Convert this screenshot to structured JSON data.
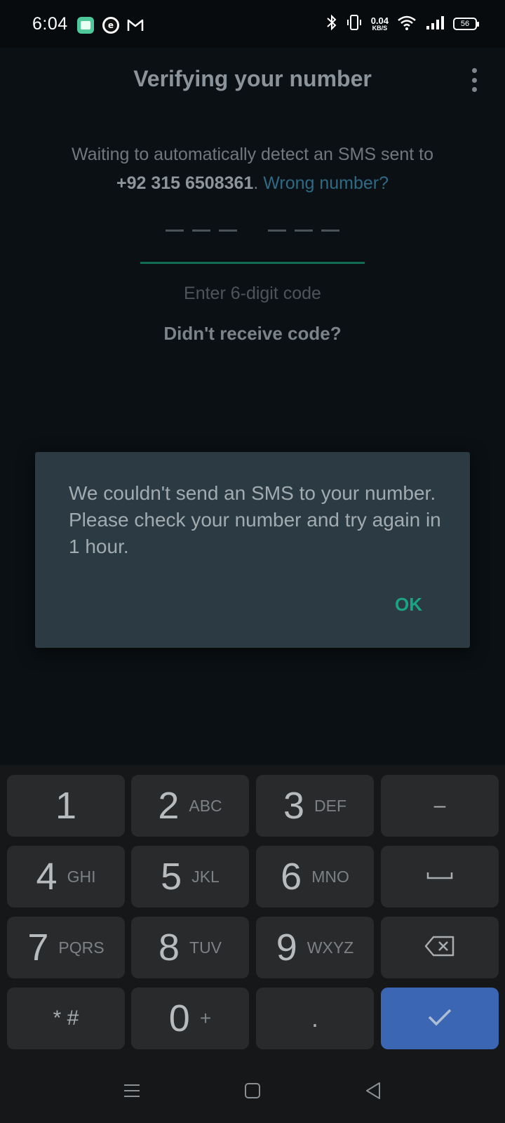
{
  "status_bar": {
    "time": "6:04",
    "net_speed_value": "0.04",
    "net_speed_unit": "KB/S",
    "battery": "56",
    "icons": [
      "app-green-icon",
      "app-e-icon",
      "gmail-icon",
      "bluetooth-icon",
      "vibrate-icon",
      "wifi-icon",
      "signal-icon",
      "battery-icon"
    ]
  },
  "header": {
    "title": "Verifying your number",
    "menu_icon": "more-vert-icon"
  },
  "verification": {
    "line1": "Waiting to automatically detect an SMS sent to",
    "phone": "+92 315 6508361",
    "period": ".",
    "wrong_number": "Wrong number?",
    "code_hint": "Enter 6-digit code",
    "resend": "Didn't receive code?"
  },
  "dialog": {
    "message": "We couldn't send an SMS to your number. Please check your number and try again in 1 hour.",
    "ok_label": "OK"
  },
  "keypad": {
    "rows": [
      [
        {
          "digit": "1",
          "letters": ""
        },
        {
          "digit": "2",
          "letters": "ABC"
        },
        {
          "digit": "3",
          "letters": "DEF"
        },
        {
          "symbol": "–"
        }
      ],
      [
        {
          "digit": "4",
          "letters": "GHI"
        },
        {
          "digit": "5",
          "letters": "JKL"
        },
        {
          "digit": "6",
          "letters": "MNO"
        },
        {
          "symbol": "space"
        }
      ],
      [
        {
          "digit": "7",
          "letters": "PQRS"
        },
        {
          "digit": "8",
          "letters": "TUV"
        },
        {
          "digit": "9",
          "letters": "WXYZ"
        },
        {
          "symbol": "backspace"
        }
      ],
      [
        {
          "digit": "* #",
          "letters": ""
        },
        {
          "digit": "0",
          "letters": "+"
        },
        {
          "digit": ".",
          "letters": ""
        },
        {
          "symbol": "enter"
        }
      ]
    ]
  },
  "colors": {
    "accent_green": "#1aa384",
    "link_blue": "#2e6a84",
    "enter_key": "#3b66b3",
    "dialog_bg": "#2b3a43"
  }
}
